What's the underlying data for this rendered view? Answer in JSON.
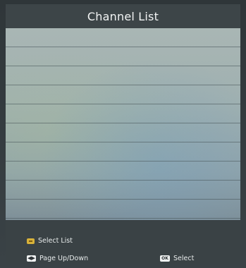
{
  "header": {
    "title": "Channel List"
  },
  "list": {
    "rows": [
      "",
      "",
      "",
      "",
      "",
      "",
      "",
      "",
      "",
      ""
    ]
  },
  "footer": {
    "select_list_label": "Select List",
    "page_label": "Page Up/Down",
    "select_label": "Select",
    "ok_key_label": "OK",
    "nav_key_label": "◀▶"
  },
  "colors": {
    "yellow_key": "#d8b23a",
    "panel": "#a9b6b4",
    "chrome": "#3a4245"
  }
}
